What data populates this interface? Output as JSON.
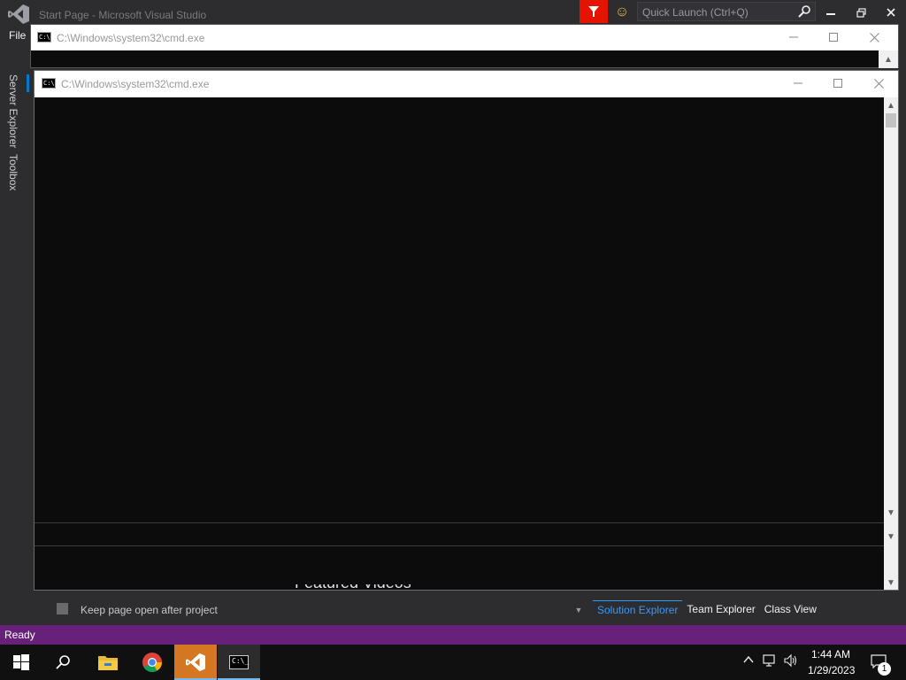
{
  "vs": {
    "title": "Start Page - Microsoft Visual Studio",
    "menu_file": "File",
    "quick_launch_placeholder": "Quick Launch (Ctrl+Q)",
    "side_tabs": [
      "Server Explorer",
      "Toolbox"
    ],
    "keep_page_label": "Keep page open after project",
    "featured_videos": "Featured Videos",
    "bottom_tabs": [
      {
        "label": "Solution Explorer",
        "active": true
      },
      {
        "label": "Team Explorer",
        "active": false
      },
      {
        "label": "Class View",
        "active": false
      }
    ],
    "status": "Ready",
    "accent_color": "#68217a",
    "feedback_color": "#e51400"
  },
  "cmd_back": {
    "title": "C:\\Windows\\system32\\cmd.exe"
  },
  "cmd_front": {
    "title": "C:\\Windows\\system32\\cmd.exe"
  },
  "taskbar": {
    "apps": [
      {
        "name": "start-icon"
      },
      {
        "name": "search-icon"
      },
      {
        "name": "file-explorer-icon"
      },
      {
        "name": "chrome-icon"
      },
      {
        "name": "visual-studio-icon"
      },
      {
        "name": "cmd-icon"
      }
    ],
    "clock_time": "1:44 AM",
    "clock_date": "1/29/2023",
    "notification_count": "1"
  }
}
